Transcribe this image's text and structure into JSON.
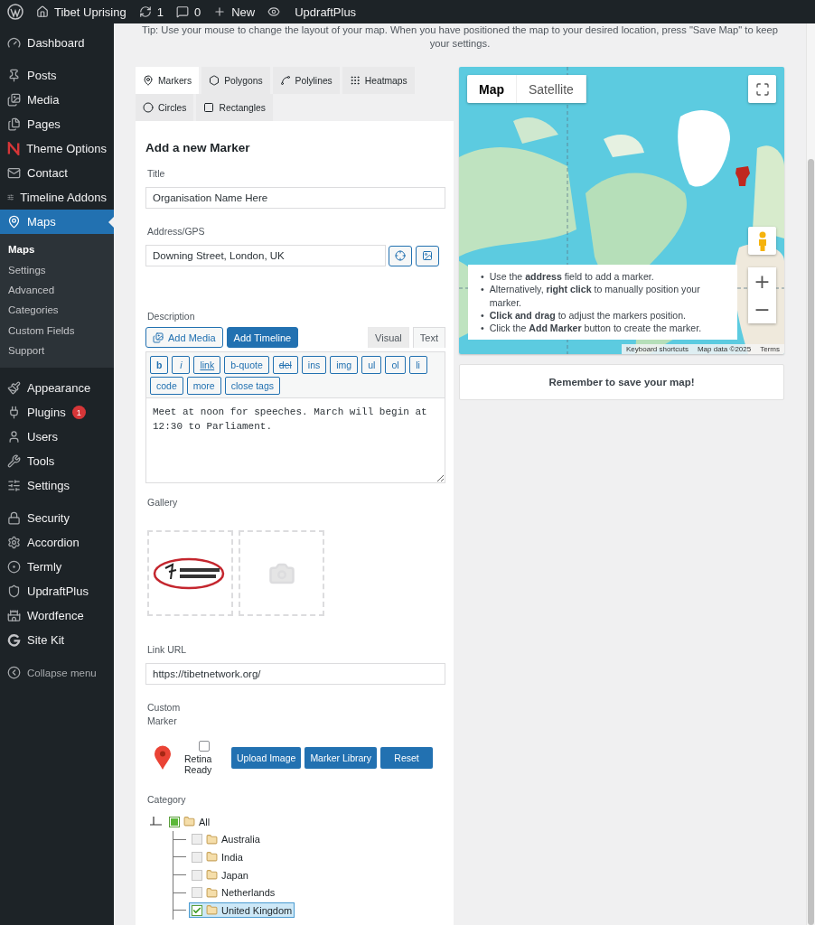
{
  "admin_bar": {
    "items": [
      {
        "label": "Tibet Uprising"
      },
      {
        "label": "1"
      },
      {
        "label": "0"
      },
      {
        "label": "New"
      },
      {
        "label": "UpdraftPlus"
      }
    ]
  },
  "sidebar": {
    "groups": [
      [
        {
          "label": "Dashboard",
          "selected": false
        }
      ],
      [
        {
          "label": "Posts",
          "selected": false
        },
        {
          "label": "Media",
          "selected": false
        },
        {
          "label": "Pages",
          "selected": false
        },
        {
          "label": "Theme Options",
          "selected": false
        },
        {
          "label": "Contact",
          "selected": false
        },
        {
          "label": "Timeline Addons",
          "selected": false
        },
        {
          "label": "Maps",
          "selected": true,
          "children": [
            {
              "label": "Maps",
              "selected": true
            },
            {
              "label": "Settings",
              "selected": false
            },
            {
              "label": "Advanced",
              "selected": false
            },
            {
              "label": "Categories",
              "selected": false
            },
            {
              "label": "Custom Fields",
              "selected": false
            },
            {
              "label": "Support",
              "selected": false
            }
          ]
        }
      ],
      [
        {
          "label": "Appearance",
          "selected": false
        },
        {
          "label": "Plugins",
          "selected": false,
          "badge": "1"
        },
        {
          "label": "Users",
          "selected": false
        },
        {
          "label": "Tools",
          "selected": false
        },
        {
          "label": "Settings",
          "selected": false
        }
      ],
      [
        {
          "label": "Security",
          "selected": false
        },
        {
          "label": "Accordion",
          "selected": false
        },
        {
          "label": "Termly",
          "selected": false
        },
        {
          "label": "UpdraftPlus",
          "selected": false
        },
        {
          "label": "Wordfence",
          "selected": false
        },
        {
          "label": "Site Kit",
          "selected": false
        }
      ]
    ],
    "collapse": {
      "label": "Collapse menu"
    }
  },
  "tip": "Tip: Use your mouse to change the layout of your map. When you have positioned the map to your desired location, press \"Save Map\" to keep your settings.",
  "tabs": [
    {
      "label": "Markers",
      "selected": true
    },
    {
      "label": "Polygons",
      "selected": false
    },
    {
      "label": "Polylines",
      "selected": false
    },
    {
      "label": "Heatmaps",
      "selected": false
    },
    {
      "label": "Circles",
      "selected": false
    },
    {
      "label": "Rectangles",
      "selected": false
    }
  ],
  "form": {
    "heading": "Add a new Marker",
    "title": {
      "label": "Title",
      "value": "Organisation Name Here"
    },
    "address": {
      "label": "Address/GPS",
      "value": "Downing Street, London, UK"
    },
    "description": {
      "label": "Description",
      "buttons": [
        {
          "label": "Add Media",
          "kind": "secondary"
        },
        {
          "label": "Add Timeline",
          "kind": "primary"
        }
      ],
      "modes": [
        {
          "label": "Visual",
          "selected": false
        },
        {
          "label": "Text",
          "selected": true
        }
      ],
      "quicktags": [
        {
          "label": "b",
          "kind": "bold"
        },
        {
          "label": "i",
          "kind": "italic"
        },
        {
          "label": "link",
          "kind": "underline"
        },
        {
          "label": "b-quote",
          "kind": "plain"
        },
        {
          "label": "del",
          "kind": "strike"
        },
        {
          "label": "ins",
          "kind": "plain"
        },
        {
          "label": "img",
          "kind": "plain"
        },
        {
          "label": "ul",
          "kind": "plain"
        },
        {
          "label": "ol",
          "kind": "plain"
        },
        {
          "label": "li",
          "kind": "plain"
        },
        {
          "label": "code",
          "kind": "plain"
        },
        {
          "label": "more",
          "kind": "plain"
        },
        {
          "label": "close tags",
          "kind": "plain"
        }
      ],
      "value": "Meet at noon for speeches. March will begin at 12:30 to Parliament."
    },
    "gallery": {
      "label": "Gallery",
      "items": [
        {
          "kind": "picture"
        },
        {
          "kind": "empty"
        }
      ]
    },
    "link": {
      "label": "Link URL",
      "value": "https://tibetnetwork.org/"
    },
    "custom_marker": {
      "label": "Custom Marker",
      "retina": {
        "label": "Retina Ready",
        "checked": false
      },
      "buttons": [
        "Upload Image",
        "Marker Library",
        "Reset"
      ]
    },
    "category": {
      "label": "Category",
      "tree": {
        "label": "All",
        "checked": false,
        "partial": true,
        "selected": false,
        "children": [
          {
            "label": "Australia",
            "checked": false,
            "selected": false
          },
          {
            "label": "India",
            "checked": false,
            "selected": false
          },
          {
            "label": "Japan",
            "checked": false,
            "selected": false
          },
          {
            "label": "Netherlands",
            "checked": false,
            "selected": false
          },
          {
            "label": "United Kingdom",
            "checked": true,
            "selected": true
          }
        ]
      }
    }
  },
  "map": {
    "kind": "picture",
    "types": [
      {
        "label": "Map",
        "selected": true
      },
      {
        "label": "Satellite",
        "selected": false
      }
    ],
    "zoom": [
      "+",
      "−"
    ],
    "help": [
      {
        "bullet": "•",
        "text": "Use the **address** field to add a marker."
      },
      {
        "bullet": "•",
        "text": "Alternatively, **right click** to manually position your marker."
      },
      {
        "bullet": "•",
        "text": "**Click and drag** to adjust the markers position."
      },
      {
        "bullet": "•",
        "text": "Click the **Add Marker** button to create the marker."
      }
    ],
    "attribution": [
      "Keyboard shortcuts",
      "Map data ©2025",
      "Terms"
    ]
  },
  "save_note": "Remember to save your map!"
}
